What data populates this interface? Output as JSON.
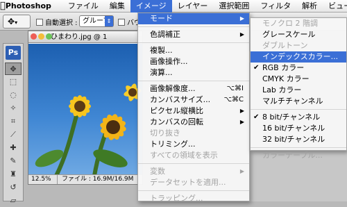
{
  "menubar": {
    "apple_icon": "apple-logo-icon",
    "app_name": "Photoshop",
    "items": [
      "ファイル",
      "編集",
      "イメージ",
      "レイヤー",
      "選択範囲",
      "フィルタ",
      "解析",
      "ビュー"
    ],
    "active_index": 2,
    "active_color": "#3b6fd6"
  },
  "options_bar": {
    "move_tool_icon": "move-arrow-icon",
    "autoselect_label": "自動選択 :",
    "group_value": "グループ",
    "bounding_label": "バウン"
  },
  "tools": {
    "badge": "Ps",
    "icons": [
      "move-tool-icon",
      "marquee-icon",
      "lasso-icon",
      "magic-wand-icon",
      "crop-icon",
      "slice-icon",
      "healing-brush-icon",
      "brush-icon",
      "stamp-icon",
      "history-brush-icon",
      "eraser-icon"
    ]
  },
  "document": {
    "title": "ひまわり.jpg @ 1",
    "zoom": "12.5%",
    "status": "ファイル : 16.9M/16.9M"
  },
  "image_menu": {
    "items": [
      {
        "label": "モード",
        "submenu": true,
        "highlighted": true
      },
      {
        "sep": true
      },
      {
        "label": "色調補正",
        "submenu": true
      },
      {
        "sep": true
      },
      {
        "label": "複製..."
      },
      {
        "label": "画像操作..."
      },
      {
        "label": "演算..."
      },
      {
        "sep": true
      },
      {
        "label": "画像解像度...",
        "shortcut": "⌥⌘I"
      },
      {
        "label": "カンバスサイズ...",
        "shortcut": "⌥⌘C"
      },
      {
        "label": "ピクセル縦横比",
        "submenu": true
      },
      {
        "label": "カンバスの回転",
        "submenu": true
      },
      {
        "label": "切り抜き",
        "disabled": true
      },
      {
        "label": "トリミング..."
      },
      {
        "label": "すべての領域を表示",
        "disabled": true
      },
      {
        "sep": true
      },
      {
        "label": "変数",
        "submenu": true,
        "disabled": true
      },
      {
        "label": "データセットを適用...",
        "disabled": true
      },
      {
        "sep": true
      },
      {
        "label": "トラッピング...",
        "disabled": true
      }
    ]
  },
  "mode_submenu": {
    "items": [
      {
        "label": "モノクロ 2 階調",
        "disabled": true
      },
      {
        "label": "グレースケール"
      },
      {
        "label": "ダブルトーン",
        "disabled": true
      },
      {
        "label": "インデックスカラー...",
        "highlighted": true
      },
      {
        "label": "RGB カラー",
        "checked": true
      },
      {
        "label": "CMYK カラー"
      },
      {
        "label": "Lab カラー"
      },
      {
        "label": "マルチチャンネル"
      },
      {
        "sep": true
      },
      {
        "label": "8 bit/チャンネル",
        "checked": true
      },
      {
        "label": "16 bit/チャンネル"
      },
      {
        "label": "32 bit/チャンネル"
      },
      {
        "sep": true
      },
      {
        "label": "カラーテーブル...",
        "disabled": true
      }
    ]
  }
}
